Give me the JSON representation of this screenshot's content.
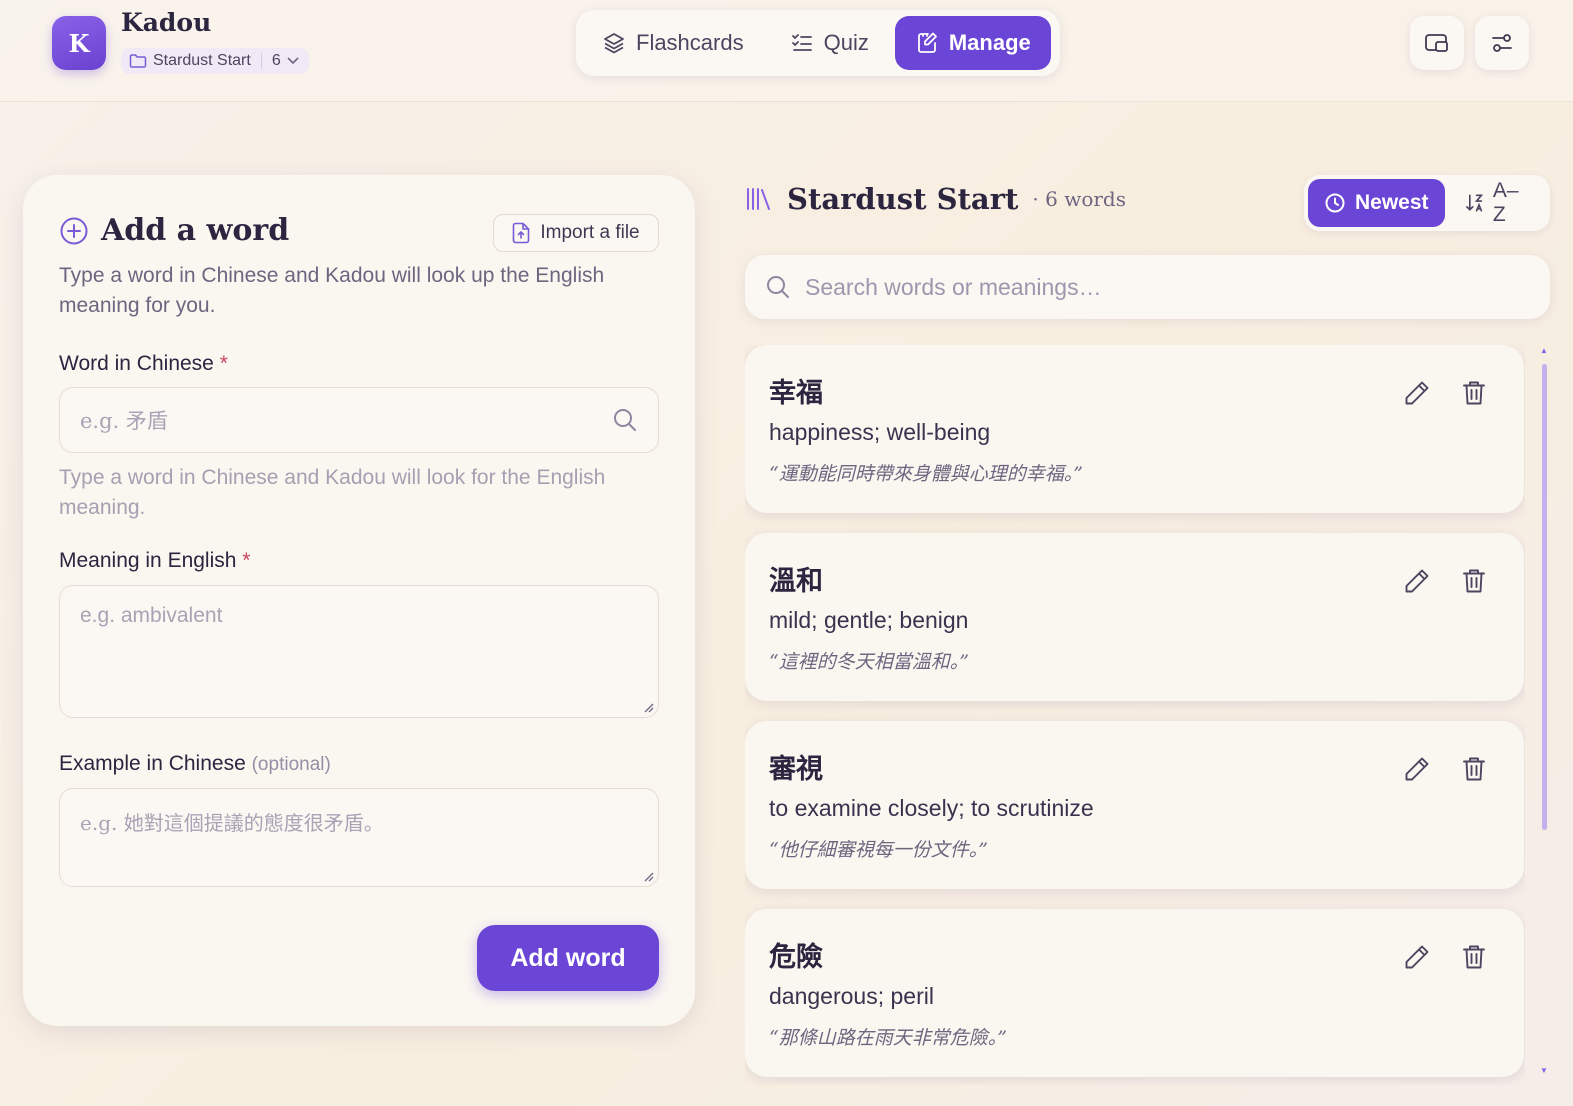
{
  "app": {
    "logo_letter": "K",
    "title": "Kadou"
  },
  "deck": {
    "name": "Stardust Start",
    "count": "6"
  },
  "nav": {
    "tabs": [
      {
        "label": "Flashcards",
        "icon": "layers-icon"
      },
      {
        "label": "Quiz",
        "icon": "list-checks-icon"
      },
      {
        "label": "Manage",
        "icon": "edit-note-icon",
        "active": true
      }
    ]
  },
  "header_actions": [
    {
      "icon": "cast-screen-icon"
    },
    {
      "icon": "sliders-icon"
    }
  ],
  "add_form": {
    "title": "Add a word",
    "import_label": "Import a file",
    "description": "Type a word in Chinese and Kadou will look up the English meaning for you.",
    "word_label": "Word in Chinese",
    "word_placeholder": "e.g. 矛盾",
    "word_hint": "Type a word in Chinese and Kadou will look for the English meaning.",
    "meaning_label": "Meaning in English",
    "meaning_placeholder": "e.g. ambivalent",
    "example_label": "Example in Chinese",
    "example_optional": "(optional)",
    "example_placeholder": "e.g. 她對這個提議的態度很矛盾。",
    "required_mark": "*",
    "submit_label": "Add word"
  },
  "list": {
    "title": "Stardust Start",
    "count_text": "· 6 words",
    "sort": {
      "newest": "Newest",
      "az": "A–Z",
      "active": "newest"
    },
    "search_placeholder": "Search words or meanings…",
    "items": [
      {
        "word": "幸福",
        "meaning": "happiness; well-being",
        "example": "“運動能同時帶來身體與心理的幸福。”"
      },
      {
        "word": "溫和",
        "meaning": "mild; gentle; benign",
        "example": "“這裡的冬天相當溫和。”"
      },
      {
        "word": "審視",
        "meaning": "to examine closely; to scrutinize",
        "example": "“他仔細審視每一份文件。”"
      },
      {
        "word": "危險",
        "meaning": "dangerous; peril",
        "example": "“那條山路在雨天非常危險。”"
      }
    ]
  },
  "colors": {
    "accent": "#6b46d6",
    "background": "#f7f1ea",
    "card": "#faf6f0",
    "required": "#c8455a"
  }
}
